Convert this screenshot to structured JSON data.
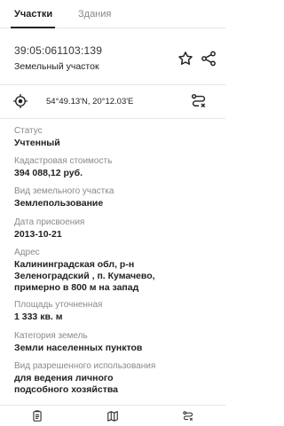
{
  "tabs": [
    {
      "label": "Участки"
    },
    {
      "label": "Здания"
    }
  ],
  "object": {
    "cadastral_number": "39:05:061103:139",
    "type": "Земельный участок"
  },
  "location": {
    "coords": "54°49.13'N, 20°12.03'E"
  },
  "attributes": [
    {
      "label": "Статус",
      "value": "Учтенный"
    },
    {
      "label": "Кадастровая стоимость",
      "value": "394 088,12 руб."
    },
    {
      "label": "Вид земельного участка",
      "value": "Землепользование"
    },
    {
      "label": "Дата присвоения",
      "value": "2013-10-21"
    },
    {
      "label": "Адрес",
      "value": "Калининградская обл, р-н\nЗеленоградский , п. Кумачево,\nпримерно в 800 м на запад"
    },
    {
      "label": "Площадь уточненная",
      "value": "1 333 кв. м"
    },
    {
      "label": "Категория земель",
      "value": "Земли населенных пунктов"
    },
    {
      "label": "Вид разрешенного использования",
      "value": "для ведения личного\nподсобного хозяйства"
    }
  ],
  "icons": {
    "favorite": "star-icon",
    "share": "share-icon",
    "locate": "target-icon",
    "route": "route-icon",
    "bottom": [
      "document-icon",
      "map-icon",
      "route-icon"
    ]
  },
  "colors": {
    "text": "#222222",
    "muted": "#8a8a8a",
    "divider": "#e6e6e6"
  }
}
